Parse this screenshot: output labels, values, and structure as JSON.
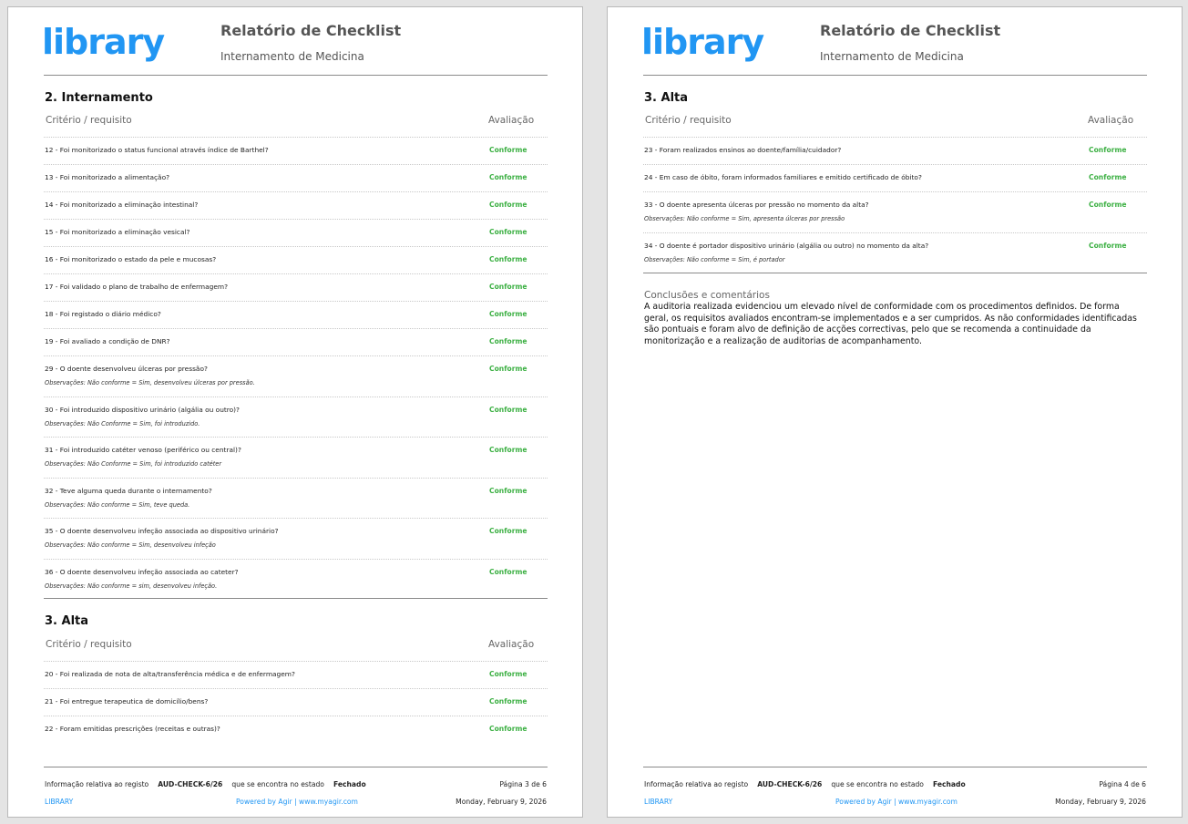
{
  "colors": {
    "brand": "#2196f3",
    "status": "#3cb043"
  },
  "header": {
    "logo": "library",
    "title": "Relatório de Checklist",
    "subtitle": "Internamento de Medicina"
  },
  "table_header": {
    "criterion": "Critério / requisito",
    "evaluation": "Avaliação"
  },
  "page1": {
    "section1": {
      "title": "2. Internamento",
      "rows": [
        {
          "q": "12 - Foi monitorizado o status funcional  através índice de Barthel?",
          "s": "Conforme"
        },
        {
          "q": "13 - Foi monitorizado a alimentação?",
          "s": "Conforme"
        },
        {
          "q": "14 - Foi monitorizado a eliminação intestinal?",
          "s": "Conforme"
        },
        {
          "q": "15 - Foi monitorizado a eliminação vesical?",
          "s": "Conforme"
        },
        {
          "q": "16 - Foi monitorizado o estado da pele e mucosas?",
          "s": "Conforme"
        },
        {
          "q": "17 - Foi validado o plano de trabalho de enfermagem?",
          "s": "Conforme"
        },
        {
          "q": "18 - Foi registado o diário médico?",
          "s": "Conforme"
        },
        {
          "q": "19 - Foi avaliado a condição de DNR?",
          "s": "Conforme"
        },
        {
          "q": "29 -  O doente desenvolveu úlceras por pressão?",
          "s": "Conforme",
          "o": "Observações: Não conforme = Sim, desenvolveu úlceras por pressão."
        },
        {
          "q": "30 -  Foi introduzido dispositivo urinário (algália  ou outro)?",
          "s": "Conforme",
          "o": "Observações: Não Conforme = Sim, foi introduzido."
        },
        {
          "q": "31 -  Foi introduzido catéter venoso  (periférico ou central)?",
          "s": "Conforme",
          "o": "Observações: Não Conforme = Sim, foi introduzido catéter"
        },
        {
          "q": "32 -  Teve alguma queda durante  o internamento?",
          "s": "Conforme",
          "o": "Observações: Não conforme = Sim, teve queda."
        },
        {
          "q": "35 -  O doente  desenvolveu  infeção  associada  ao dispositivo  urinário?",
          "s": "Conforme",
          "o": "Observações: Não conforme = Sim, desenvolveu infeção"
        },
        {
          "q": "36 -  O doente  desenvolveu infeção associada ao cateter?",
          "s": "Conforme",
          "o": "Observações: Não conforme = sim, desenvolveu infeção."
        }
      ]
    },
    "section2": {
      "title": "3. Alta",
      "rows": [
        {
          "q": "20 - Foi realizada de nota de alta/transferência médica  e de enfermagem?",
          "s": "Conforme"
        },
        {
          "q": "21 - Foi entregue terapeutica  de domicílio/bens?",
          "s": "Conforme"
        },
        {
          "q": "22 -  Foram  emitidas prescrições  (receitas e outras)?",
          "s": "Conforme"
        }
      ]
    },
    "footer": {
      "info_prefix": "Informação relativa ao registo",
      "record_code": "AUD-CHECK-6/26",
      "info_mid": "que se encontra no estado",
      "state": "Fechado",
      "page": "Página 3 de 6",
      "brand": "LIBRARY",
      "powered": "Powered by Agir | www.myagir.com",
      "date": "Monday, February 9, 2026"
    }
  },
  "page2": {
    "section1": {
      "title": "3. Alta",
      "rows": [
        {
          "q": "23 -  Foram  realizados  ensinos  ao  doente/família/cuidador?",
          "s": "Conforme"
        },
        {
          "q": "24 -  Em  caso de óbito,  foram  informados familiares  e  emitido certificado  de óbito?",
          "s": "Conforme"
        },
        {
          "q": "33 - O doente apresenta úlceras por pressão no momento da alta?",
          "s": "Conforme",
          "o": "Observações: Não conforme = Sim, apresenta úlceras por pressão"
        },
        {
          "q": "34 -  O  doente  é  portador  dispositivo  urinário  (algália  ou  outro)  no  momento  da  alta?",
          "s": "Conforme",
          "o": "Observações: Não conforme = Sim, é portador"
        }
      ]
    },
    "conclusions": {
      "label": "Conclusões e comentários",
      "text": "A auditoria realizada evidenciou um elevado nível de conformidade com os procedimentos definidos. De forma geral, os requisitos avaliados encontram-se implementados e a ser cumpridos. As não conformidades identificadas são pontuais e foram alvo de definição de acções correctivas, pelo que se recomenda a continuidade da monitorização e a realização de auditorias de acompanhamento."
    },
    "footer": {
      "info_prefix": "Informação relativa ao registo",
      "record_code": "AUD-CHECK-6/26",
      "info_mid": "que se encontra no estado",
      "state": "Fechado",
      "page": "Página 4 de 6",
      "brand": "LIBRARY",
      "powered": "Powered by Agir | www.myagir.com",
      "date": "Monday, February 9, 2026"
    }
  }
}
